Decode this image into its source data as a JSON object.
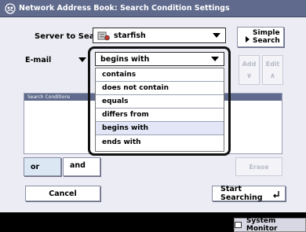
{
  "title": "Network Address Book: Search Condition Settings",
  "server": {
    "label": "Server to Search:",
    "value": "starfish"
  },
  "simple_search_label": [
    "Simple",
    "Search"
  ],
  "field_select": {
    "value": "E-mail"
  },
  "condition_select": {
    "value": "begins with",
    "options": [
      "contains",
      "does not contain",
      "equals",
      "differs from",
      "begins with",
      "ends with"
    ],
    "selected": "begins with"
  },
  "buttons": {
    "add": "Add",
    "edit": "Edit",
    "or": "or",
    "and": "and",
    "erase": "Erase",
    "cancel": "Cancel",
    "start_searching": "Start Searching"
  },
  "conditions_header": "Search Conditions",
  "system_monitor": "System Monitor",
  "colors": {
    "title_bar": "#5f6a8c",
    "panel_bg": "#ececf4",
    "highlight": "#e2e6f6"
  }
}
